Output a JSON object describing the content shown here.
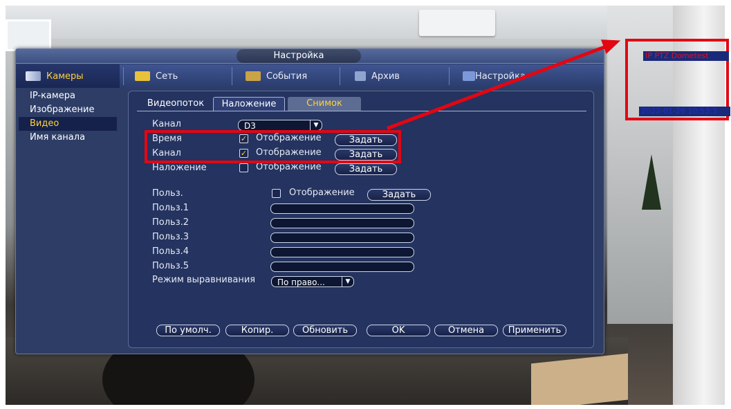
{
  "dialog": {
    "title": "Настройка"
  },
  "topnav": {
    "items": [
      {
        "label": "Камеры",
        "icon": "camera-icon"
      },
      {
        "label": "Сеть",
        "icon": "network-icon"
      },
      {
        "label": "События",
        "icon": "events-icon"
      },
      {
        "label": "Архив",
        "icon": "archive-icon"
      },
      {
        "label": "Настройка",
        "icon": "settings-icon"
      }
    ]
  },
  "sidebar": {
    "items": [
      {
        "label": "IP-камера"
      },
      {
        "label": "Изображение"
      },
      {
        "label": "Видео",
        "active": true
      },
      {
        "label": "Имя канала"
      }
    ]
  },
  "tabs": [
    "Видеопоток",
    "Наложение",
    "Снимок"
  ],
  "form": {
    "channel_label": "Канал",
    "channel_value": "D3",
    "rows": [
      {
        "label": "Время",
        "checked": true,
        "check_label": "Отображение",
        "button": "Задать"
      },
      {
        "label": "Канал",
        "checked": true,
        "check_label": "Отображение",
        "button": "Задать"
      },
      {
        "label": "Наложение",
        "checked": false,
        "check_label": "Отображение",
        "button": "Задать"
      }
    ],
    "user": {
      "label": "Польз.",
      "checked": false,
      "check_label": "Отображение",
      "button": "Задать"
    },
    "user_fields": [
      "Польз.1",
      "Польз.2",
      "Польз.3",
      "Польз.4",
      "Польз.5"
    ],
    "align_label": "Режим выравнивания",
    "align_value": "По право..."
  },
  "buttons": {
    "default": "По умолч.",
    "copy": "Копир.",
    "refresh": "Обновить",
    "ok": "OK",
    "cancel": "Отмена",
    "apply": "Применить"
  },
  "preview": {
    "title_text": "IP PTZ Dometest",
    "time_text": "2022-01-26 10:53:3"
  },
  "colors": {
    "highlight": "#e30613",
    "accent": "#ffd23a",
    "panel": "#24335f"
  }
}
